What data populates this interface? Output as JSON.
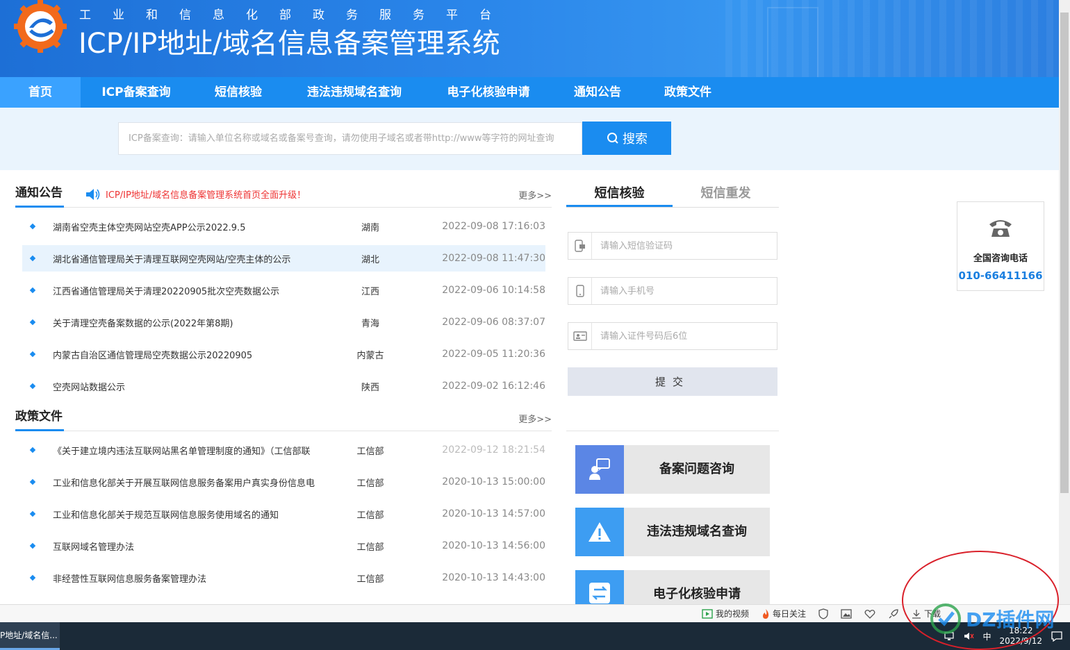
{
  "header": {
    "org_name": "工业和信息化部政务服务平台",
    "system_title": "ICP/IP地址/域名信息备案管理系统"
  },
  "nav": {
    "items": [
      {
        "label": "首页",
        "active": true
      },
      {
        "label": "ICP备案查询"
      },
      {
        "label": "短信核验"
      },
      {
        "label": "违法违规域名查询"
      },
      {
        "label": "电子化核验申请"
      },
      {
        "label": "通知公告"
      },
      {
        "label": "政策文件"
      }
    ]
  },
  "search": {
    "placeholder": "ICP备案查询：请输入单位名称或域名或备案号查询，请勿使用子域名或者带http://www等字符的网址查询",
    "button_label": "搜索"
  },
  "notices": {
    "title": "通知公告",
    "marquee": "ICP/IP地址/域名信息备案管理系统首页全面升级！",
    "more": "更多>>",
    "rows": [
      {
        "title": "湖南省空壳主体空壳网站空壳APP公示2022.9.5",
        "region": "湖南",
        "date": "2022-09-08 17:16:03"
      },
      {
        "title": "湖北省通信管理局关于清理互联网空壳网站/空壳主体的公示",
        "region": "湖北",
        "date": "2022-09-08 11:47:30"
      },
      {
        "title": "江西省通信管理局关于清理20220905批次空壳数据公示",
        "region": "江西",
        "date": "2022-09-06 10:14:58"
      },
      {
        "title": "关于清理空壳备案数据的公示(2022年第8期)",
        "region": "青海",
        "date": "2022-09-06 08:37:07"
      },
      {
        "title": "内蒙古自治区通信管理局空壳数据公示20220905",
        "region": "内蒙古",
        "date": "2022-09-05 11:20:36"
      },
      {
        "title": "空壳网站数据公示",
        "region": "陕西",
        "date": "2022-09-02 16:12:46"
      }
    ]
  },
  "policies": {
    "title": "政策文件",
    "more": "更多>>",
    "rows": [
      {
        "title": "《关于建立境内违法互联网站黑名单管理制度的通知》（工信部联",
        "region": "工信部",
        "date": "2022-09-12 18:21:54"
      },
      {
        "title": "工业和信息化部关于开展互联网信息服务备案用户真实身份信息电",
        "region": "工信部",
        "date": "2020-10-13 15:00:00"
      },
      {
        "title": "工业和信息化部关于规范互联网信息服务使用域名的通知",
        "region": "工信部",
        "date": "2020-10-13 14:57:00"
      },
      {
        "title": "互联网域名管理办法",
        "region": "工信部",
        "date": "2020-10-13 14:56:00"
      },
      {
        "title": "非经营性互联网信息服务备案管理办法",
        "region": "工信部",
        "date": "2020-10-13 14:43:00"
      }
    ]
  },
  "sms": {
    "tabs": [
      "短信核验",
      "短信重发"
    ],
    "code_placeholder": "请输入短信验证码",
    "phone_placeholder": "请输入手机号",
    "id_placeholder": "请输入证件号码后6位",
    "submit_label": "提交"
  },
  "quick_links": [
    {
      "label": "备案问题咨询",
      "icon": "consult-icon",
      "color": "#5b86e5"
    },
    {
      "label": "违法违规域名查询",
      "icon": "warning-icon",
      "color": "#3d9df2"
    },
    {
      "label": "电子化核验申请",
      "icon": "exchange-icon",
      "color": "#3d9df2"
    }
  ],
  "hotline": {
    "label": "全国咨询电话",
    "number": "010-66411166"
  },
  "statusbar": {
    "items": [
      "我的视频",
      "每日关注",
      "下载"
    ]
  },
  "taskbar": {
    "app_title": "P地址/域名信...",
    "ime": "中",
    "time": "18:22",
    "date": "2022/9/12"
  },
  "watermark": "DZ插件网",
  "colors": {
    "primary": "#1a8cf0",
    "banner": "#2a86ea",
    "marquee_red": "#e33333",
    "annotation_red": "#d9202a"
  }
}
